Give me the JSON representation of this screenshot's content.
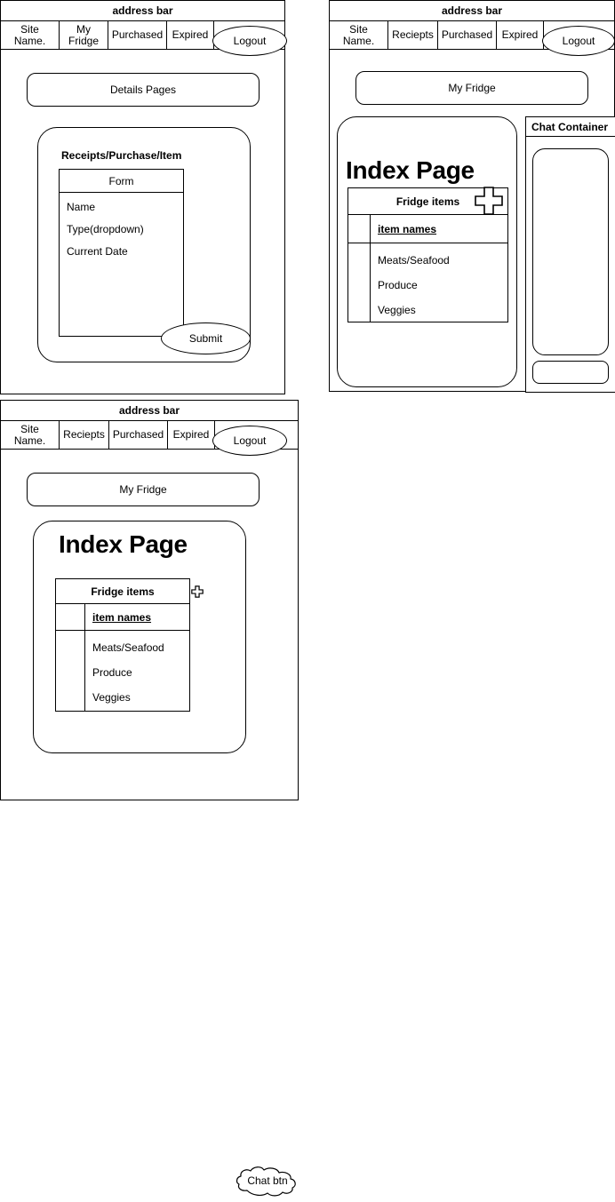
{
  "meta": {
    "doc_title": "Fridge app wireframe mockups"
  },
  "panels": {
    "details": {
      "address_bar": "address bar",
      "nav": [
        {
          "label": "Site Name.",
          "shape": "rect"
        },
        {
          "label": "My Fridge",
          "shape": "rect"
        },
        {
          "label": "Purchased",
          "shape": "rect"
        },
        {
          "label": "Expired",
          "shape": "rect"
        },
        {
          "label": "Logout",
          "shape": "ellipse"
        }
      ],
      "header_button": "Details Pages",
      "card_title": "Receipts/Purchase/Item",
      "form": {
        "header": "Form",
        "fields": [
          "Name",
          "Type(dropdown)",
          "Current Date"
        ]
      },
      "submit_button": "Submit"
    },
    "index_with_chat": {
      "address_bar": "address bar",
      "nav": [
        {
          "label": "Site Name.",
          "shape": "rect"
        },
        {
          "label": "Reciepts",
          "shape": "rect"
        },
        {
          "label": "Purchased",
          "shape": "rect"
        },
        {
          "label": "Expired",
          "shape": "rect"
        },
        {
          "label": "Logout",
          "shape": "ellipse"
        }
      ],
      "header_button": "My Fridge",
      "page_title": "Index Page",
      "table": {
        "header": "Fridge items",
        "add_icon": "plus-icon",
        "column_header": "item names",
        "rows": [
          "Meats/Seafood",
          "Produce",
          "Veggies"
        ]
      },
      "chat": {
        "title": "Chat Container"
      }
    },
    "index_with_chat_btn": {
      "address_bar": "address bar",
      "nav": [
        {
          "label": "Site Name.",
          "shape": "rect"
        },
        {
          "label": "Reciepts",
          "shape": "rect"
        },
        {
          "label": "Purchased",
          "shape": "rect"
        },
        {
          "label": "Expired",
          "shape": "rect"
        },
        {
          "label": "Logout",
          "shape": "ellipse"
        }
      ],
      "header_button": "My Fridge",
      "page_title": "Index Page",
      "table": {
        "header": "Fridge items",
        "add_icon": "plus-icon",
        "column_header": "item names",
        "rows": [
          "Meats/Seafood",
          "Produce",
          "Veggies"
        ]
      },
      "chat_button": "Chat btn"
    }
  }
}
